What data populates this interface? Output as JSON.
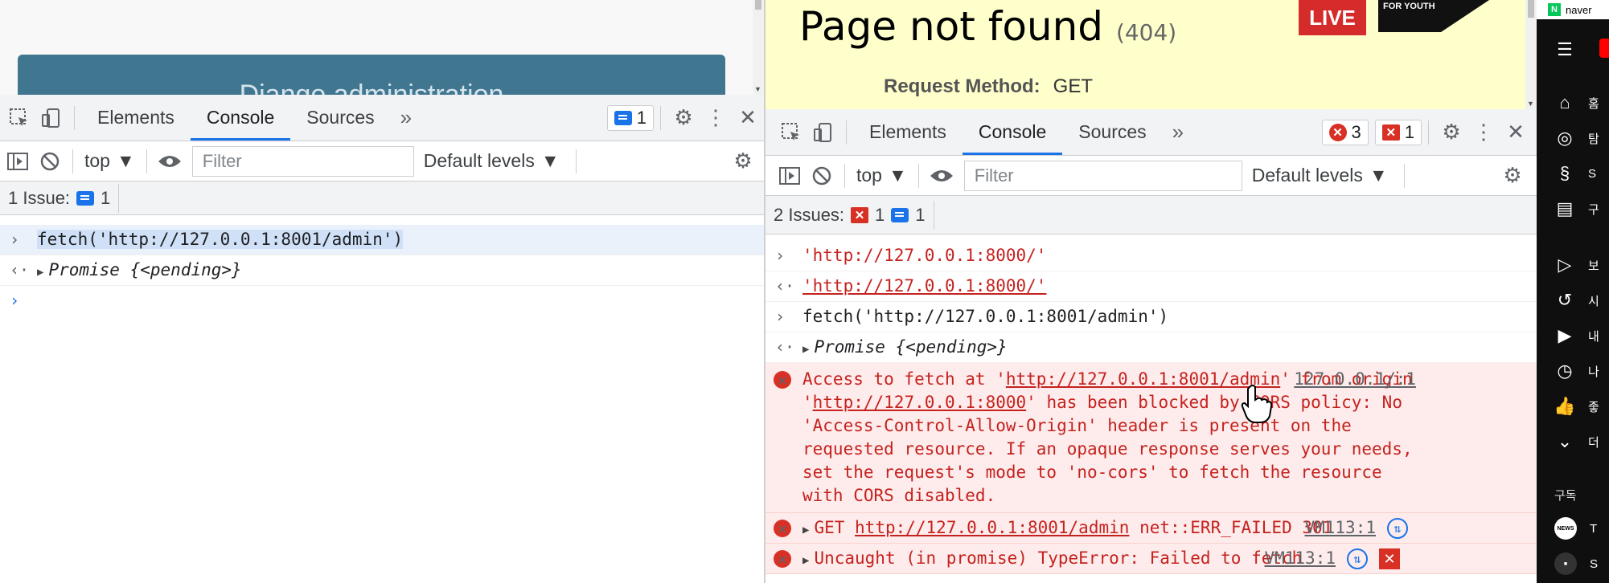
{
  "left": {
    "page_banner": "Django administration",
    "tabs": [
      "Elements",
      "Console",
      "Sources"
    ],
    "message_badge_count": "1",
    "context": "top",
    "filter_placeholder": "Filter",
    "levels": "Default levels",
    "issues_label": "1 Issue:",
    "issues_count": "1",
    "console": {
      "input_cmd": "fetch('http://127.0.0.1:8001/admin')",
      "output_label": "Promise",
      "output_state": "{<pending>}"
    }
  },
  "right": {
    "page_title": "Page not found",
    "page_code": "(404)",
    "request_label": "Request Method:",
    "request_value": "GET",
    "live_label": "LIVE",
    "youth_label": "FOR YOUTH",
    "tabs": [
      "Elements",
      "Console",
      "Sources"
    ],
    "error_count": "3",
    "warn_count": "1",
    "context": "top",
    "filter_placeholder": "Filter",
    "levels": "Default levels",
    "issues_label": "2 Issues:",
    "issues_err": "1",
    "issues_info": "1",
    "console": {
      "line1_input": "'http://127.0.0.1:8000/'",
      "line2_output": "'http://127.0.0.1:8000/'",
      "line3_input": "fetch('http://127.0.0.1:8001/admin')",
      "line4_label": "Promise",
      "line4_state": "{<pending>}",
      "cors_pre": "Access to fetch at '",
      "cors_url": "http://127.0.0.1:8001/admin",
      "cors_mid": "' from origin '",
      "cors_origin": "http://127.0.0.1:8000",
      "cors_post": "' has been blocked by CORS policy: No 'Access-Control-Allow-Origin' header is present on the requested resource. If an opaque response serves your needs, set the request's mode to 'no-cors' to fetch the resource with CORS disabled.",
      "cors_source": "127.0.0.1/:1",
      "get_method": "GET",
      "get_url": "http://127.0.0.1:8001/admin",
      "get_status": "net::ERR_FAILED 301",
      "get_source": "VM113:1",
      "uncaught_text": "Uncaught (in promise) TypeError: Failed to fetch",
      "uncaught_source": "VM113:1"
    }
  },
  "youtube": {
    "top_label": "naver",
    "subscriptions_label": "구독",
    "items": [
      "홈",
      "탐",
      "S",
      "구",
      "보",
      "시",
      "내",
      "나",
      "좋",
      "더"
    ],
    "channels": [
      "T",
      "S"
    ]
  }
}
